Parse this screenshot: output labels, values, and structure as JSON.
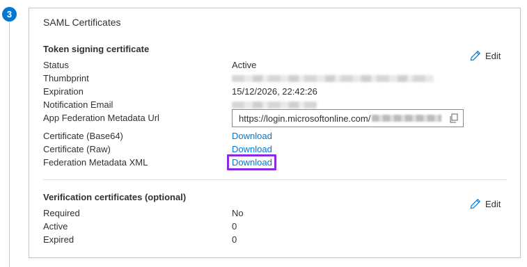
{
  "step": {
    "number": "3"
  },
  "card": {
    "title": "SAML Certificates"
  },
  "token_section": {
    "title": "Token signing certificate",
    "edit_label": "Edit",
    "rows": {
      "status": {
        "label": "Status",
        "value": "Active"
      },
      "thumbprint": {
        "label": "Thumbprint"
      },
      "expiration": {
        "label": "Expiration",
        "value": "15/12/2026, 22:42:26"
      },
      "notification_email": {
        "label": "Notification Email"
      },
      "metadata_url": {
        "label": "App Federation Metadata Url",
        "value": "https://login.microsoftonline.com/"
      },
      "cert_base64": {
        "label": "Certificate (Base64)",
        "link": "Download"
      },
      "cert_raw": {
        "label": "Certificate (Raw)",
        "link": "Download"
      },
      "federation_xml": {
        "label": "Federation Metadata XML",
        "link": "Download"
      }
    }
  },
  "verification_section": {
    "title": "Verification certificates (optional)",
    "edit_label": "Edit",
    "rows": {
      "required": {
        "label": "Required",
        "value": "No"
      },
      "active": {
        "label": "Active",
        "value": "0"
      },
      "expired": {
        "label": "Expired",
        "value": "0"
      }
    }
  },
  "icons": {
    "edit": "pencil-icon",
    "copy": "copy-icon"
  },
  "colors": {
    "accent": "#0078d4",
    "highlight": "#8a2be2",
    "text": "#323130",
    "border": "#c8c6c4"
  }
}
